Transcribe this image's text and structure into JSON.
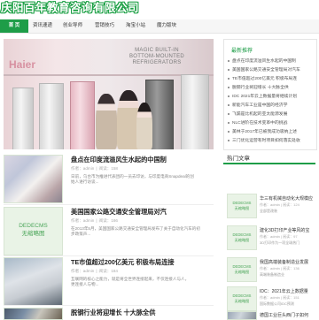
{
  "site": {
    "logo_text": "庆阳百年教育咨询有限公司"
  },
  "nav": {
    "items": [
      {
        "label": "首 页",
        "active": true
      },
      {
        "label": "资讯速递",
        "active": false
      },
      {
        "label": "创业导师",
        "active": false
      },
      {
        "label": "营销技巧",
        "active": false
      },
      {
        "label": "淘宝小站",
        "active": false
      },
      {
        "label": "魔力版块",
        "active": false
      }
    ]
  },
  "banner": {
    "sign_text": "MAGIC BUILT-IN BOTTOM-MOUNTED REFRIGERATORS",
    "brand_text": "Haier"
  },
  "recommend": {
    "title": "最新推荐",
    "items": [
      "盘点在印度流溢风生水起的中国制",
      "美国国家公路交通安全管理局对汽车",
      "TE市值超过200亿美元 积极布局连",
      "脱钢行业将迎增长 十大脉全供",
      "IDC 2021年云上数据量将继续计划",
      "新能汽车工业是中国的经济学",
      "飞漏是比机起的亚太能源发展",
      "NLC进阶在技术变革中的挑战",
      "美林于2017年已被我成功吸纳上述",
      "三门优化运营有时项目如何落实处收"
    ]
  },
  "articles": [
    {
      "title": "盘点在印度流溢风生水起的中国制",
      "author_label": "作者：",
      "author": "admin",
      "views_label": "阅读：",
      "views": "158",
      "desc1": "日前，乌台市为推进代表团的一员去印访，与印度电商Snapdeal的创",
      "desc2": "始人进行访谈..."
    },
    {
      "title": "美国国家公路交通安全管理局对汽",
      "author_label": "作者：",
      "author": "admin",
      "views_label": "阅读：",
      "views": "166",
      "thumb_line1": "DEDECMS",
      "thumb_line2": "无缩略图",
      "desc1": "在2013年5月，美国国家公路交通安全管理局发布了关于自动化汽车的初",
      "desc2": "步政策声..."
    },
    {
      "title": "TE市值超过200亿美元 积极布局连接",
      "author_label": "作者：",
      "author": "admin",
      "views_label": "阅读：",
      "views": "184",
      "desc1": "互联网的核心之能力，就是将全世界连接起来，不仅连接人与人，",
      "desc2": "更连接人与物..."
    },
    {
      "title": "脱钢行业将迎增长 十大脉全供",
      "author_label": "",
      "author": "",
      "views_label": "",
      "views": "",
      "desc1": "",
      "desc2": ""
    }
  ],
  "hot": {
    "title": "热门文章",
    "items": [
      {
        "title": "华三有机械自动化大规模应",
        "author_label": "作者：",
        "author": "admin",
        "views_label": "阅读：",
        "views": "124",
        "desc": "全部是改装",
        "thumb_line1": "DEDECMS",
        "thumb_line2": "无缩略图"
      },
      {
        "title": "建化3D打印产业等风的宝",
        "author_label": "作者：",
        "author": "admin",
        "views_label": "阅读：",
        "views": "97",
        "desc": "3D打印作为一项全球热门",
        "thumb_line1": "DEDECMS",
        "thumb_line2": "无缩略图"
      },
      {
        "title": "我国高端装备制造业发展",
        "author_label": "作者：",
        "author": "admin",
        "views_label": "阅读：",
        "views": "136",
        "desc": "高端装备制造业",
        "thumb_line1": "DEDECMS",
        "thumb_line2": "无缩略图"
      },
      {
        "title": "IDC：2021年云上数据量",
        "author_label": "作者：",
        "author": "admin",
        "views_label": "阅读：",
        "views": "151",
        "desc": "国际数据公司IDC预测",
        "thumb_line1": "DEDECMS",
        "thumb_line2": "无缩略图"
      },
      {
        "title": "德国工业巨头西门子如何",
        "author_label": "",
        "author": "",
        "views_label": "",
        "views": "",
        "desc": "",
        "thumb_line1": "",
        "thumb_line2": ""
      }
    ]
  },
  "colors": {
    "accent": "#1e9d48",
    "nav_bg": "#f6f6f6",
    "thumb_bg": "#e9f3e6"
  }
}
